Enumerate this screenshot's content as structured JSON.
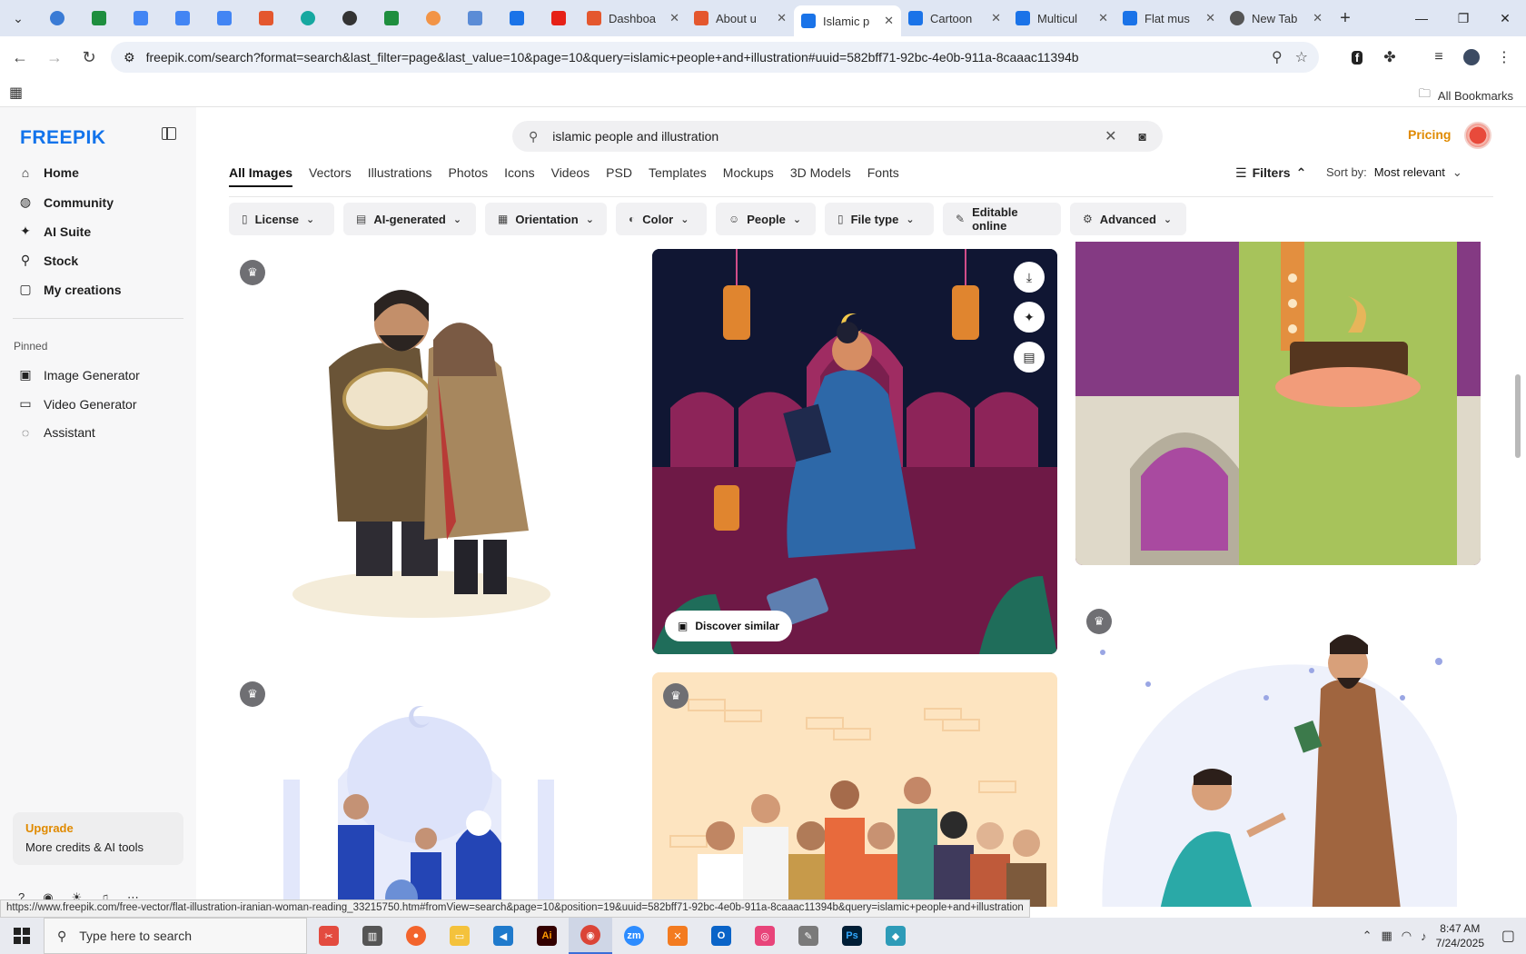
{
  "browser": {
    "tabs": [
      {
        "label": "Dashboa",
        "fav": "#e4572e"
      },
      {
        "label": "About u",
        "fav": "#e4572e"
      },
      {
        "label": "Islamic p",
        "fav": "#1a73e8",
        "active": true
      },
      {
        "label": "Cartoon",
        "fav": "#1a73e8"
      },
      {
        "label": "Multicul",
        "fav": "#1a73e8"
      },
      {
        "label": "Flat mus",
        "fav": "#1a73e8"
      },
      {
        "label": "New Tab",
        "fav": "#555555"
      }
    ],
    "url": "freepik.com/search?format=search&last_filter=page&last_value=10&page=10&query=islamic+people+and+illustration#uuid=582bff71-92bc-4e0b-911a-8caaac11394b",
    "all_bookmarks": "All Bookmarks"
  },
  "sidebar": {
    "logo": "FREEPIK",
    "items": [
      {
        "label": "Home",
        "icon": "home-icon",
        "glyph": "⌂"
      },
      {
        "label": "Community",
        "icon": "globe-icon",
        "glyph": "◍"
      },
      {
        "label": "AI Suite",
        "icon": "sparkle-icon",
        "glyph": "✦"
      },
      {
        "label": "Stock",
        "icon": "search-icon",
        "glyph": "⚲"
      },
      {
        "label": "My creations",
        "icon": "folder-icon",
        "glyph": "▢"
      }
    ],
    "pinned_label": "Pinned",
    "pinned": [
      {
        "label": "Image Generator",
        "icon": "image-icon",
        "glyph": "▣"
      },
      {
        "label": "Video Generator",
        "icon": "video-icon",
        "glyph": "▭"
      },
      {
        "label": "Assistant",
        "icon": "assistant-icon",
        "glyph": "◌"
      }
    ],
    "upgrade_title": "Upgrade",
    "upgrade_sub": "More credits & AI tools"
  },
  "search": {
    "query": "islamic people and illustration"
  },
  "header": {
    "pricing": "Pricing"
  },
  "type_tabs": [
    "All Images",
    "Vectors",
    "Illustrations",
    "Photos",
    "Icons",
    "Videos",
    "PSD",
    "Templates",
    "Mockups",
    "3D Models",
    "Fonts"
  ],
  "filters_label": "Filters",
  "sort": {
    "label": "Sort by:",
    "value": "Most relevant"
  },
  "chips": [
    {
      "label": "License",
      "glyph": "▯"
    },
    {
      "label": "AI-generated",
      "glyph": "▤"
    },
    {
      "label": "Orientation",
      "glyph": "▦"
    },
    {
      "label": "Color",
      "glyph": "◐"
    },
    {
      "label": "People",
      "glyph": "☺"
    },
    {
      "label": "File type",
      "glyph": "▯"
    },
    {
      "label": "Editable online",
      "glyph": "✎"
    },
    {
      "label": "Advanced",
      "glyph": "⚙"
    }
  ],
  "discover_label": "Discover similar",
  "status_link": "https://www.freepik.com/free-vector/flat-illustration-iranian-woman-reading_33215750.htm#fromView=search&page=10&position=19&uuid=582bff71-92bc-4e0b-911a-8caaac11394b&query=islamic+people+and+illustration",
  "taskbar": {
    "search_placeholder": "Type here to search",
    "time": "8:47 AM",
    "date": "7/24/2025"
  },
  "colors": {
    "brand": "#1273eb",
    "accent_orange": "#e08a00"
  }
}
